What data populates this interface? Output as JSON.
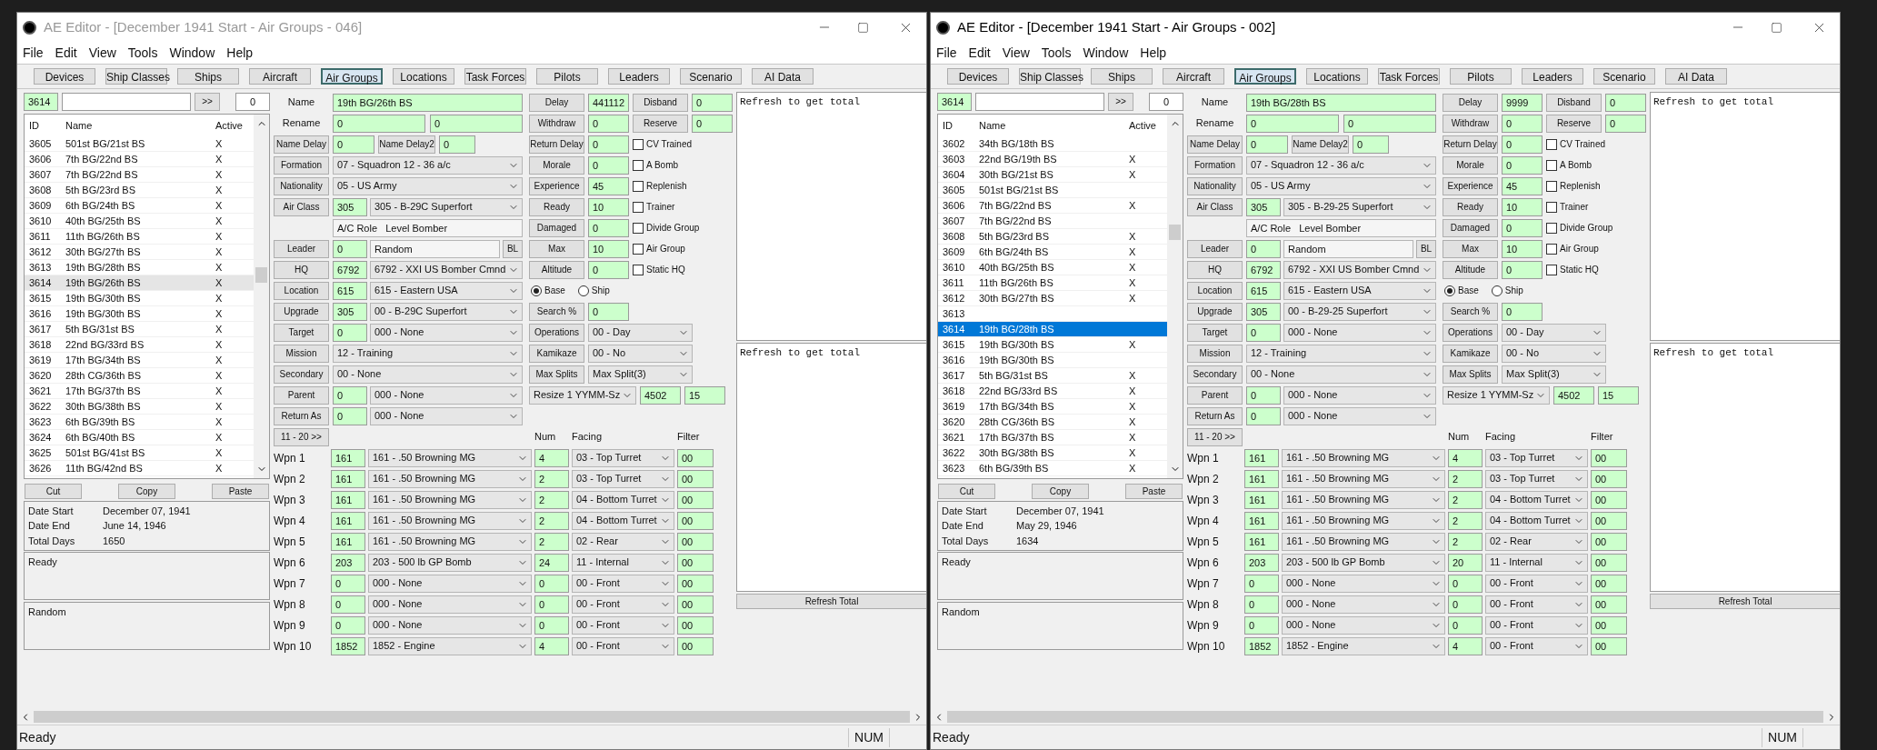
{
  "windows": [
    {
      "title": "AE Editor - [December 1941 Start - Air Groups - 046]",
      "active": false,
      "menu": [
        "File",
        "Edit",
        "View",
        "Tools",
        "Window",
        "Help"
      ],
      "tabs": [
        {
          "label": "Devices",
          "selected": false
        },
        {
          "label": "Ship Classes",
          "selected": false
        },
        {
          "label": "Ships",
          "selected": false
        },
        {
          "label": "Aircraft",
          "selected": false
        },
        {
          "label": "Air Groups",
          "selected": true
        },
        {
          "label": "Locations",
          "selected": false
        },
        {
          "label": "Task Forces",
          "selected": false
        },
        {
          "label": "Pilots",
          "selected": false
        },
        {
          "label": "Leaders",
          "selected": false
        },
        {
          "label": "Scenario",
          "selected": false
        },
        {
          "label": "AI Data",
          "selected": false
        }
      ],
      "lookup": {
        "id": "3614",
        "go_button": ">>",
        "count": "0"
      },
      "list": {
        "columns": [
          "ID",
          "Name",
          "Active"
        ],
        "rows": [
          {
            "id": "3605",
            "name": "501st BG/21st BS",
            "active": "X",
            "selected": false
          },
          {
            "id": "3606",
            "name": "7th BG/22nd BS",
            "active": "X",
            "selected": false
          },
          {
            "id": "3607",
            "name": "7th BG/22nd BS",
            "active": "X",
            "selected": false
          },
          {
            "id": "3608",
            "name": "5th BG/23rd BS",
            "active": "X",
            "selected": false
          },
          {
            "id": "3609",
            "name": "6th BG/24th BS",
            "active": "X",
            "selected": false
          },
          {
            "id": "3610",
            "name": "40th BG/25th BS",
            "active": "X",
            "selected": false
          },
          {
            "id": "3611",
            "name": "11th BG/26th BS",
            "active": "X",
            "selected": false
          },
          {
            "id": "3612",
            "name": "30th BG/27th BS",
            "active": "X",
            "selected": false
          },
          {
            "id": "3613",
            "name": "19th BG/28th BS",
            "active": "X",
            "selected": false
          },
          {
            "id": "3614",
            "name": "19th BG/26th BS",
            "active": "X",
            "selected": true
          },
          {
            "id": "3615",
            "name": "19th BG/30th BS",
            "active": "X",
            "selected": false
          },
          {
            "id": "3616",
            "name": "19th BG/30th BS",
            "active": "X",
            "selected": false
          },
          {
            "id": "3617",
            "name": "5th BG/31st BS",
            "active": "X",
            "selected": false
          },
          {
            "id": "3618",
            "name": "22nd BG/33rd BS",
            "active": "X",
            "selected": false
          },
          {
            "id": "3619",
            "name": "17th BG/34th BS",
            "active": "X",
            "selected": false
          },
          {
            "id": "3620",
            "name": "28th CG/36th BS",
            "active": "X",
            "selected": false
          },
          {
            "id": "3621",
            "name": "17th BG/37th BS",
            "active": "X",
            "selected": false
          },
          {
            "id": "3622",
            "name": "30th BG/38th BS",
            "active": "X",
            "selected": false
          },
          {
            "id": "3623",
            "name": "6th BG/39th BS",
            "active": "X",
            "selected": false
          },
          {
            "id": "3624",
            "name": "6th BG/40th BS",
            "active": "X",
            "selected": false
          },
          {
            "id": "3625",
            "name": "501st BG/41st BS",
            "active": "X",
            "selected": false
          },
          {
            "id": "3626",
            "name": "11th BG/42nd BS",
            "active": "X",
            "selected": false
          }
        ]
      },
      "edit_buttons": [
        "Cut",
        "Copy",
        "Paste"
      ],
      "dates": [
        {
          "label": "Date Start",
          "value": "December 07, 1941"
        },
        {
          "label": "Date End",
          "value": "June 14, 1946"
        },
        {
          "label": "Total Days",
          "value": "1650"
        }
      ],
      "status_box": "Ready",
      "leader_box": "Random",
      "form_left": [
        {
          "kind": "text",
          "label": "Name",
          "value": "19th BG/26th BS"
        },
        {
          "kind": "rename",
          "label": "Rename",
          "values": [
            "0",
            "0"
          ]
        },
        {
          "kind": "delay",
          "label": "Name Delay",
          "value": "0",
          "label2": "Name Delay2",
          "value2": "0"
        },
        {
          "kind": "select",
          "label": "Formation",
          "value": "07 - Squadron 12 - 36 a/c"
        },
        {
          "kind": "select",
          "label": "Nationality",
          "value": "05 - US Army"
        },
        {
          "kind": "code_select",
          "label": "Air Class",
          "code": "305",
          "value": "305 - B-29C Superfort"
        },
        {
          "kind": "role",
          "value": "A/C Role   Level Bomber"
        },
        {
          "kind": "leader",
          "label": "Leader",
          "code": "0",
          "value": "Random",
          "button": "BL"
        },
        {
          "kind": "code_select",
          "label": "HQ",
          "code": "6792",
          "value": "6792 - XXI US Bomber Cmnd"
        },
        {
          "kind": "code_select",
          "label": "Location",
          "code": "615",
          "value": "615 - Eastern USA"
        },
        {
          "kind": "code_select",
          "label": "Upgrade",
          "code": "305",
          "value": "00 - B-29C Superfort"
        },
        {
          "kind": "code_select",
          "label": "Target",
          "code": "0",
          "value": "000 - None"
        },
        {
          "kind": "select",
          "label": "Mission",
          "value": "12 - Training"
        },
        {
          "kind": "select",
          "label": "Secondary",
          "value": "00 - None"
        },
        {
          "kind": "code_select",
          "label": "Parent",
          "code": "0",
          "value": "000 - None"
        },
        {
          "kind": "code_select",
          "label": "Return As",
          "code": "0",
          "value": "000 - None"
        }
      ],
      "form_right": [
        {
          "kind": "pair",
          "label": "Delay",
          "value": "441112",
          "label2": "Disband",
          "value2": "0"
        },
        {
          "kind": "pair",
          "label": "Withdraw",
          "value": "0",
          "label2": "Reserve",
          "value2": "0"
        },
        {
          "kind": "check",
          "label": "Return Delay",
          "value": "0",
          "check": "CV Trained",
          "checked": false
        },
        {
          "kind": "check",
          "label": "Morale",
          "value": "0",
          "check": "A Bomb",
          "checked": false
        },
        {
          "kind": "check",
          "label": "Experience",
          "value": "45",
          "check": "Replenish",
          "checked": false
        },
        {
          "kind": "check",
          "label": "Ready",
          "value": "10",
          "check": "Trainer",
          "checked": false
        },
        {
          "kind": "check",
          "label": "Damaged",
          "value": "0",
          "check": "Divide Group",
          "checked": false
        },
        {
          "kind": "check",
          "label": "Max",
          "value": "10",
          "check": "Air Group",
          "checked": false
        },
        {
          "kind": "check",
          "label": "Altitude",
          "value": "0",
          "check": "Static HQ",
          "checked": false
        },
        {
          "kind": "radio",
          "options": [
            {
              "label": "Base",
              "selected": true
            },
            {
              "label": "Ship",
              "selected": false
            }
          ]
        },
        {
          "kind": "number",
          "label": "Search %",
          "value": "0"
        },
        {
          "kind": "select",
          "label": "Operations",
          "value": "00 - Day"
        },
        {
          "kind": "select",
          "label": "Kamikaze",
          "value": "00 - No"
        },
        {
          "kind": "select",
          "label": "Max Splits",
          "value": "Max Split(3)"
        },
        {
          "kind": "resize",
          "value": "Resize 1 YYMM-Sz",
          "fields": [
            "4502",
            "15"
          ]
        }
      ],
      "next_button": "11 - 20  >>",
      "weapons": {
        "columns": [
          "Num",
          "Facing",
          "Filter"
        ],
        "rows": [
          {
            "label": "Wpn 1",
            "code": "161",
            "name": "161 - .50 Browning MG",
            "num": "4",
            "facing": "03 - Top Turret",
            "filter": "00"
          },
          {
            "label": "Wpn 2",
            "code": "161",
            "name": "161 - .50 Browning MG",
            "num": "2",
            "facing": "03 - Top Turret",
            "filter": "00"
          },
          {
            "label": "Wpn 3",
            "code": "161",
            "name": "161 - .50 Browning MG",
            "num": "2",
            "facing": "04 - Bottom Turret",
            "filter": "00"
          },
          {
            "label": "Wpn 4",
            "code": "161",
            "name": "161 - .50 Browning MG",
            "num": "2",
            "facing": "04 - Bottom Turret",
            "filter": "00"
          },
          {
            "label": "Wpn 5",
            "code": "161",
            "name": "161 - .50 Browning MG",
            "num": "2",
            "facing": "02 - Rear",
            "filter": "00"
          },
          {
            "label": "Wpn 6",
            "code": "203",
            "name": "203 - 500 lb GP Bomb",
            "num": "24",
            "facing": "11 - Internal",
            "filter": "00"
          },
          {
            "label": "Wpn 7",
            "code": "0",
            "name": "000 - None",
            "num": "0",
            "facing": "00 - Front",
            "filter": "00"
          },
          {
            "label": "Wpn 8",
            "code": "0",
            "name": "000 - None",
            "num": "0",
            "facing": "00 - Front",
            "filter": "00"
          },
          {
            "label": "Wpn 9",
            "code": "0",
            "name": "000 - None",
            "num": "0",
            "facing": "00 - Front",
            "filter": "00"
          },
          {
            "label": "Wpn 10",
            "code": "1852",
            "name": "1852 - Engine",
            "num": "4",
            "facing": "00 - Front",
            "filter": "00"
          }
        ]
      },
      "panels": [
        "Refresh to get total",
        "Refresh to get total"
      ],
      "refresh_button": "Refresh Total",
      "status_bar": {
        "text": "Ready",
        "indicator": "NUM"
      }
    },
    {
      "title": "AE Editor - [December 1941 Start - Air Groups - 002]",
      "active": true,
      "menu": [
        "File",
        "Edit",
        "View",
        "Tools",
        "Window",
        "Help"
      ],
      "tabs": [
        {
          "label": "Devices",
          "selected": false
        },
        {
          "label": "Ship Classes",
          "selected": false
        },
        {
          "label": "Ships",
          "selected": false
        },
        {
          "label": "Aircraft",
          "selected": false
        },
        {
          "label": "Air Groups",
          "selected": true
        },
        {
          "label": "Locations",
          "selected": false
        },
        {
          "label": "Task Forces",
          "selected": false
        },
        {
          "label": "Pilots",
          "selected": false
        },
        {
          "label": "Leaders",
          "selected": false
        },
        {
          "label": "Scenario",
          "selected": false
        },
        {
          "label": "AI Data",
          "selected": false
        }
      ],
      "lookup": {
        "id": "3614",
        "go_button": ">>",
        "count": "0"
      },
      "list": {
        "columns": [
          "ID",
          "Name",
          "Active"
        ],
        "rows": [
          {
            "id": "3602",
            "name": "34th BG/18th BS",
            "selected": false
          },
          {
            "id": "3603",
            "name": "22nd BG/19th BS",
            "active": "X",
            "selected": false
          },
          {
            "id": "3604",
            "name": "30th BG/21st BS",
            "active": "X",
            "selected": false
          },
          {
            "id": "3605",
            "name": "501st BG/21st BS",
            "selected": false
          },
          {
            "id": "3606",
            "name": "7th BG/22nd BS",
            "active": "X",
            "selected": false
          },
          {
            "id": "3607",
            "name": "7th BG/22nd BS",
            "selected": false
          },
          {
            "id": "3608",
            "name": "5th BG/23rd BS",
            "active": "X",
            "selected": false
          },
          {
            "id": "3609",
            "name": "6th BG/24th BS",
            "active": "X",
            "selected": false
          },
          {
            "id": "3610",
            "name": "40th BG/25th BS",
            "active": "X",
            "selected": false
          },
          {
            "id": "3611",
            "name": "11th BG/26th BS",
            "active": "X",
            "selected": false
          },
          {
            "id": "3612",
            "name": "30th BG/27th BS",
            "active": "X",
            "selected": false
          },
          {
            "id": "3613",
            "selected": false
          },
          {
            "id": "3614",
            "name": "19th BG/28th BS",
            "selected": true
          },
          {
            "id": "3615",
            "name": "19th BG/30th BS",
            "active": "X",
            "selected": false
          },
          {
            "id": "3616",
            "name": "19th BG/30th BS",
            "selected": false
          },
          {
            "id": "3617",
            "name": "5th BG/31st BS",
            "active": "X",
            "selected": false
          },
          {
            "id": "3618",
            "name": "22nd BG/33rd BS",
            "active": "X",
            "selected": false
          },
          {
            "id": "3619",
            "name": "17th BG/34th BS",
            "active": "X",
            "selected": false
          },
          {
            "id": "3620",
            "name": "28th CG/36th BS",
            "active": "X",
            "selected": false
          },
          {
            "id": "3621",
            "name": "17th BG/37th BS",
            "active": "X",
            "selected": false
          },
          {
            "id": "3622",
            "name": "30th BG/38th BS",
            "active": "X",
            "selected": false
          },
          {
            "id": "3623",
            "name": "6th BG/39th BS",
            "active": "X",
            "selected": false
          }
        ]
      },
      "edit_buttons": [
        "Cut",
        "Copy",
        "Paste"
      ],
      "dates": [
        {
          "label": "Date Start",
          "value": "December 07, 1941"
        },
        {
          "label": "Date End",
          "value": "May 29, 1946"
        },
        {
          "label": "Total Days",
          "value": "1634"
        }
      ],
      "status_box": "Ready",
      "leader_box": "Random",
      "form_left": [
        {
          "kind": "text",
          "label": "Name",
          "value": "19th BG/28th BS"
        },
        {
          "kind": "rename",
          "label": "Rename",
          "values": [
            "0",
            "0"
          ]
        },
        {
          "kind": "delay",
          "label": "Name Delay",
          "value": "0",
          "label2": "Name Delay2",
          "value2": "0"
        },
        {
          "kind": "select",
          "label": "Formation",
          "value": "07 - Squadron 12 - 36 a/c"
        },
        {
          "kind": "select",
          "label": "Nationality",
          "value": "05 - US Army"
        },
        {
          "kind": "code_select",
          "label": "Air Class",
          "code": "305",
          "value": "305 - B-29-25 Superfort"
        },
        {
          "kind": "role",
          "value": "A/C Role   Level Bomber"
        },
        {
          "kind": "leader",
          "label": "Leader",
          "code": "0",
          "value": "Random",
          "button": "BL"
        },
        {
          "kind": "code_select",
          "label": "HQ",
          "code": "6792",
          "value": "6792 - XXI US Bomber Cmnd"
        },
        {
          "kind": "code_select",
          "label": "Location",
          "code": "615",
          "value": "615 - Eastern USA"
        },
        {
          "kind": "code_select",
          "label": "Upgrade",
          "code": "305",
          "value": "00 - B-29-25 Superfort"
        },
        {
          "kind": "code_select",
          "label": "Target",
          "code": "0",
          "value": "000 - None"
        },
        {
          "kind": "select",
          "label": "Mission",
          "value": "12 - Training"
        },
        {
          "kind": "select",
          "label": "Secondary",
          "value": "00 - None"
        },
        {
          "kind": "code_select",
          "label": "Parent",
          "code": "0",
          "value": "000 - None"
        },
        {
          "kind": "code_select",
          "label": "Return As",
          "code": "0",
          "value": "000 - None"
        }
      ],
      "form_right": [
        {
          "kind": "pair",
          "label": "Delay",
          "value": "9999",
          "label2": "Disband",
          "value2": "0"
        },
        {
          "kind": "pair",
          "label": "Withdraw",
          "value": "0",
          "label2": "Reserve",
          "value2": "0"
        },
        {
          "kind": "check",
          "label": "Return Delay",
          "value": "0",
          "check": "CV Trained",
          "checked": false
        },
        {
          "kind": "check",
          "label": "Morale",
          "value": "0",
          "check": "A Bomb",
          "checked": false
        },
        {
          "kind": "check",
          "label": "Experience",
          "value": "45",
          "check": "Replenish",
          "checked": false
        },
        {
          "kind": "check",
          "label": "Ready",
          "value": "10",
          "check": "Trainer",
          "checked": false
        },
        {
          "kind": "check",
          "label": "Damaged",
          "value": "0",
          "check": "Divide Group",
          "checked": false
        },
        {
          "kind": "check",
          "label": "Max",
          "value": "10",
          "check": "Air Group",
          "checked": false
        },
        {
          "kind": "check",
          "label": "Altitude",
          "value": "0",
          "check": "Static HQ",
          "checked": false
        },
        {
          "kind": "radio",
          "options": [
            {
              "label": "Base",
              "selected": true
            },
            {
              "label": "Ship",
              "selected": false
            }
          ]
        },
        {
          "kind": "number",
          "label": "Search %",
          "value": "0"
        },
        {
          "kind": "select",
          "label": "Operations",
          "value": "00 - Day"
        },
        {
          "kind": "select",
          "label": "Kamikaze",
          "value": "00 - No"
        },
        {
          "kind": "select",
          "label": "Max Splits",
          "value": "Max Split(3)"
        },
        {
          "kind": "resize",
          "value": "Resize 1 YYMM-Sz",
          "fields": [
            "4502",
            "15"
          ]
        }
      ],
      "next_button": "11 - 20 >>",
      "weapons": {
        "columns": [
          "Num",
          "Facing",
          "Filter"
        ],
        "rows": [
          {
            "label": "Wpn 1",
            "code": "161",
            "name": "161 - .50 Browning MG",
            "num": "4",
            "facing": "03 - Top Turret",
            "filter": "00"
          },
          {
            "label": "Wpn 2",
            "code": "161",
            "name": "161 - .50 Browning MG",
            "num": "2",
            "facing": "03 - Top Turret",
            "filter": "00"
          },
          {
            "label": "Wpn 3",
            "code": "161",
            "name": "161 - .50 Browning MG",
            "num": "2",
            "facing": "04 - Bottom Turret",
            "filter": "00"
          },
          {
            "label": "Wpn 4",
            "code": "161",
            "name": "161 - .50 Browning MG",
            "num": "2",
            "facing": "04 - Bottom Turret",
            "filter": "00"
          },
          {
            "label": "Wpn 5",
            "code": "161",
            "name": "161 - .50 Browning MG",
            "num": "2",
            "facing": "02 - Rear",
            "filter": "00"
          },
          {
            "label": "Wpn 6",
            "code": "203",
            "name": "203 - 500 lb GP Bomb",
            "num": "20",
            "facing": "11 - Internal",
            "filter": "00"
          },
          {
            "label": "Wpn 7",
            "code": "0",
            "name": "000 - None",
            "num": "0",
            "facing": "00 - Front",
            "filter": "00"
          },
          {
            "label": "Wpn 8",
            "code": "0",
            "name": "000 - None",
            "num": "0",
            "facing": "00 - Front",
            "filter": "00"
          },
          {
            "label": "Wpn 9",
            "code": "0",
            "name": "000 - None",
            "num": "0",
            "facing": "00 - Front",
            "filter": "00"
          },
          {
            "label": "Wpn 10",
            "code": "1852",
            "name": "1852 - Engine",
            "num": "4",
            "facing": "00 - Front",
            "filter": "00"
          }
        ]
      },
      "panels": [
        "Refresh to get total",
        "Refresh to get total"
      ],
      "refresh_button": "Refresh Total",
      "status_bar": {
        "text": "Ready",
        "indicator": "NUM"
      }
    }
  ]
}
